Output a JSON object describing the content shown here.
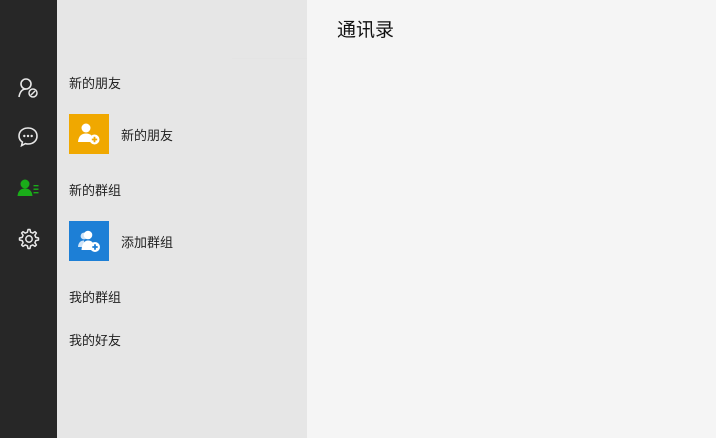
{
  "window": {
    "title": "通讯录"
  },
  "rail": {
    "items": [
      {
        "icon": "person-search-icon",
        "active": false
      },
      {
        "icon": "chat-bubble-icon",
        "active": false
      },
      {
        "icon": "contacts-icon",
        "active": true
      },
      {
        "icon": "gear-icon",
        "active": false
      }
    ],
    "active_color": "#1aad19",
    "icon_color": "#e8e8e8"
  },
  "list": {
    "new_friends_header": "新的朋友",
    "new_friends_entry": {
      "label": "新的朋友",
      "icon": "add-friend-icon",
      "color": "#f0a800"
    },
    "new_groups_header": "新的群组",
    "add_group_entry": {
      "label": "添加群组",
      "icon": "add-group-icon",
      "color": "#1d7fd6"
    },
    "my_groups": "我的群组",
    "my_friends": "我的好友"
  }
}
